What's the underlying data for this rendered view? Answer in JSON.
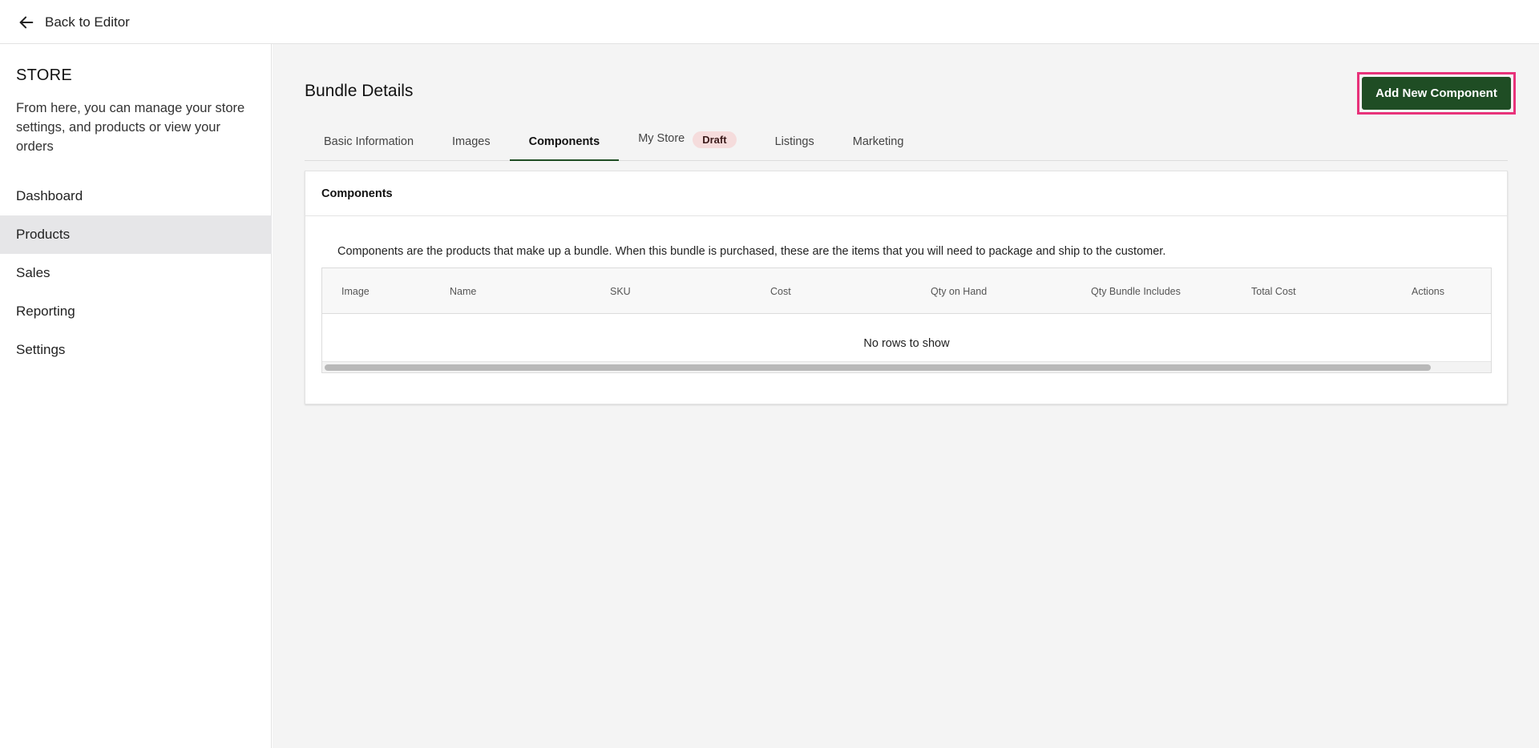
{
  "topbar": {
    "back_label": "Back to Editor"
  },
  "sidebar": {
    "title": "STORE",
    "description": "From here, you can manage your store settings, and products or view your orders",
    "items": [
      {
        "label": "Dashboard",
        "active": false
      },
      {
        "label": "Products",
        "active": true
      },
      {
        "label": "Sales",
        "active": false
      },
      {
        "label": "Reporting",
        "active": false
      },
      {
        "label": "Settings",
        "active": false
      }
    ]
  },
  "main": {
    "title": "Bundle Details",
    "add_button_label": "Add New Component",
    "tabs": [
      {
        "label": "Basic Information"
      },
      {
        "label": "Images"
      },
      {
        "label": "Components",
        "active": true
      },
      {
        "label": "My Store",
        "badge": "Draft"
      },
      {
        "label": "Listings"
      },
      {
        "label": "Marketing"
      }
    ],
    "card": {
      "title": "Components",
      "description": "Components are the products that make up a bundle. When this bundle is purchased, these are the items that you will need to package and ship to the customer.",
      "columns": [
        "Image",
        "Name",
        "SKU",
        "Cost",
        "Qty on Hand",
        "Qty Bundle Includes",
        "Total Cost",
        "Actions"
      ],
      "empty_text": "No rows to show"
    }
  },
  "colors": {
    "accent": "#1f4d24",
    "highlight_border": "#e8327a",
    "badge_bg": "#f5dcdc"
  }
}
